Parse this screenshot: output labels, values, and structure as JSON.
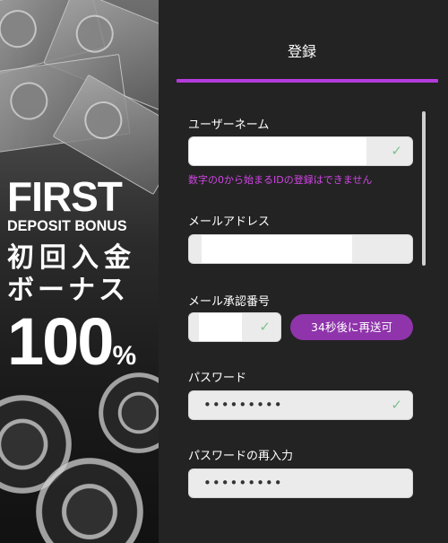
{
  "banner": {
    "line1": "FIRST",
    "line2": "DEPOSIT BONUS",
    "line3": "初回入金",
    "line4": "ボーナス",
    "percent_number": "100",
    "percent_sign": "%"
  },
  "form": {
    "title": "登録",
    "username": {
      "label": "ユーザーネーム",
      "error": "数字の0から始まるIDの登録はできません",
      "valid": true
    },
    "email": {
      "label": "メールアドレス"
    },
    "verification": {
      "label": "メール承認番号",
      "valid": true,
      "resend_label": "34秒後に再送可"
    },
    "password": {
      "label": "パスワード",
      "value": "•••••••••",
      "valid": true
    },
    "password_confirm": {
      "label": "パスワードの再入力",
      "value": "•••••••••"
    }
  },
  "colors": {
    "accent": "#b43bdb",
    "button": "#8f34ab",
    "error": "#d245e6",
    "check": "#7ec28f"
  },
  "icons": {
    "valid": "check-icon"
  }
}
